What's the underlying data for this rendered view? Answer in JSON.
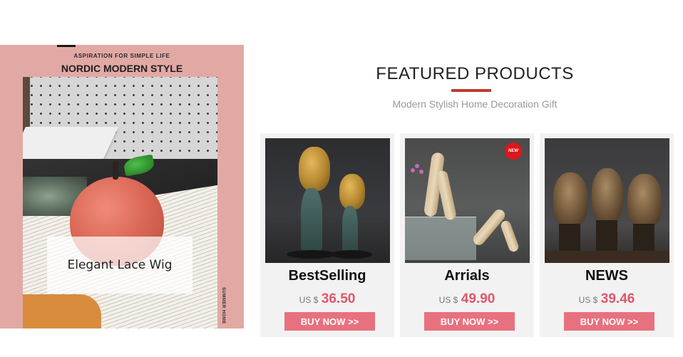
{
  "hero": {
    "kicker": "ASPIRATION FOR SIMPLE LIFE",
    "title": "NORDIC MODERN STYLE",
    "side_text": "SUMMER HOME",
    "label": "Elegant Lace Wig"
  },
  "section": {
    "heading": "FEATURED PRODUCTS",
    "subheading": "Modern Stylish Home Decoration Gift"
  },
  "products": [
    {
      "title": "BestSelling",
      "currency": "US $",
      "price": "36.50",
      "button": "BUY NOW >>",
      "image": "gold-face-sculpture"
    },
    {
      "title": "Arrials",
      "currency": "US $",
      "price": "49.90",
      "button": "BUY NOW >>",
      "badge": "NEW",
      "image": "yoga-figure-sculpture"
    },
    {
      "title": "NEWS",
      "currency": "US $",
      "price": "39.46",
      "button": "BUY NOW >>",
      "image": "bronze-head-sculpture"
    }
  ],
  "colors": {
    "accent": "#c0392b",
    "price": "#e0566a",
    "button": "#e8717f",
    "hero_bg": "#e2a9a4",
    "card_bg": "#f2f2f2"
  }
}
